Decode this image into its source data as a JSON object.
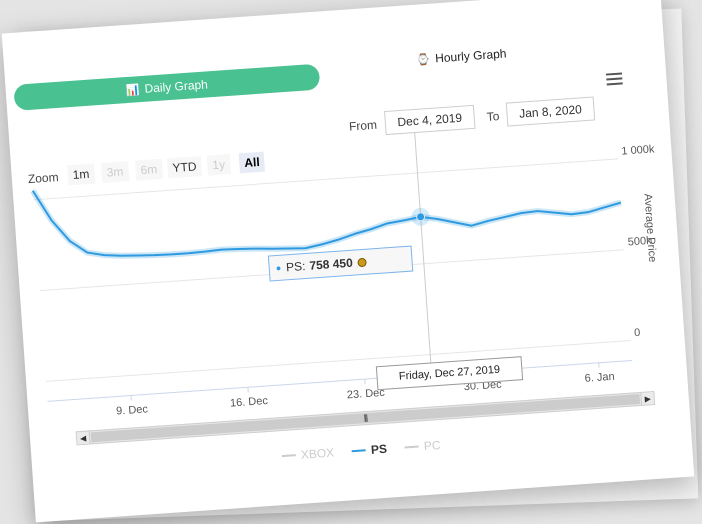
{
  "tabs": {
    "daily_label": "Daily Graph",
    "hourly_label": "Hourly Graph"
  },
  "range": {
    "from_label": "From",
    "from_value": "Dec 4, 2019",
    "to_label": "To",
    "to_value": "Jan 8, 2020"
  },
  "zoom": {
    "label": "Zoom",
    "buttons": [
      {
        "label": "1m",
        "state": "enabled"
      },
      {
        "label": "3m",
        "state": "disabled"
      },
      {
        "label": "6m",
        "state": "disabled"
      },
      {
        "label": "YTD",
        "state": "enabled"
      },
      {
        "label": "1y",
        "state": "disabled"
      },
      {
        "label": "All",
        "state": "selected"
      }
    ]
  },
  "tooltip": {
    "series": "PS:",
    "value": "758 450",
    "date": "Friday, Dec 27, 2019"
  },
  "legend": {
    "items": [
      {
        "label": "XBOX",
        "active": false
      },
      {
        "label": "PS",
        "active": true
      },
      {
        "label": "PC",
        "active": false
      }
    ]
  },
  "colors": {
    "accent": "#49c191",
    "series_ps": "#2f9ae0",
    "inactive": "#cccccc"
  },
  "chart_data": {
    "type": "line",
    "title": "",
    "ylabel": "Average Price",
    "ylim": [
      0,
      1000000
    ],
    "y_ticks": [
      "0",
      "500k",
      "1 000k"
    ],
    "x_ticks": [
      "9. Dec",
      "16. Dec",
      "23. Dec",
      "30. Dec",
      "6. Jan"
    ],
    "grid": true,
    "legend_position": "bottom-center",
    "series": [
      {
        "name": "PS",
        "x": [
          "Dec 4",
          "Dec 5",
          "Dec 6",
          "Dec 7",
          "Dec 8",
          "Dec 9",
          "Dec 10",
          "Dec 11",
          "Dec 12",
          "Dec 13",
          "Dec 14",
          "Dec 15",
          "Dec 16",
          "Dec 17",
          "Dec 18",
          "Dec 19",
          "Dec 20",
          "Dec 21",
          "Dec 22",
          "Dec 23",
          "Dec 24",
          "Dec 25",
          "Dec 26",
          "Dec 27",
          "Dec 28",
          "Dec 29",
          "Dec 30",
          "Dec 31",
          "Jan 1",
          "Jan 2",
          "Jan 3",
          "Jan 4",
          "Jan 5",
          "Jan 6",
          "Jan 7",
          "Jan 8"
        ],
        "values": [
          1050000,
          880000,
          760000,
          690000,
          670000,
          660000,
          655000,
          650000,
          648000,
          648000,
          650000,
          655000,
          652000,
          648000,
          640000,
          635000,
          630000,
          645000,
          665000,
          690000,
          710000,
          735000,
          745000,
          758450,
          740000,
          715000,
          690000,
          710000,
          725000,
          740000,
          745000,
          730000,
          715000,
          720000,
          740000,
          760000
        ]
      }
    ]
  }
}
